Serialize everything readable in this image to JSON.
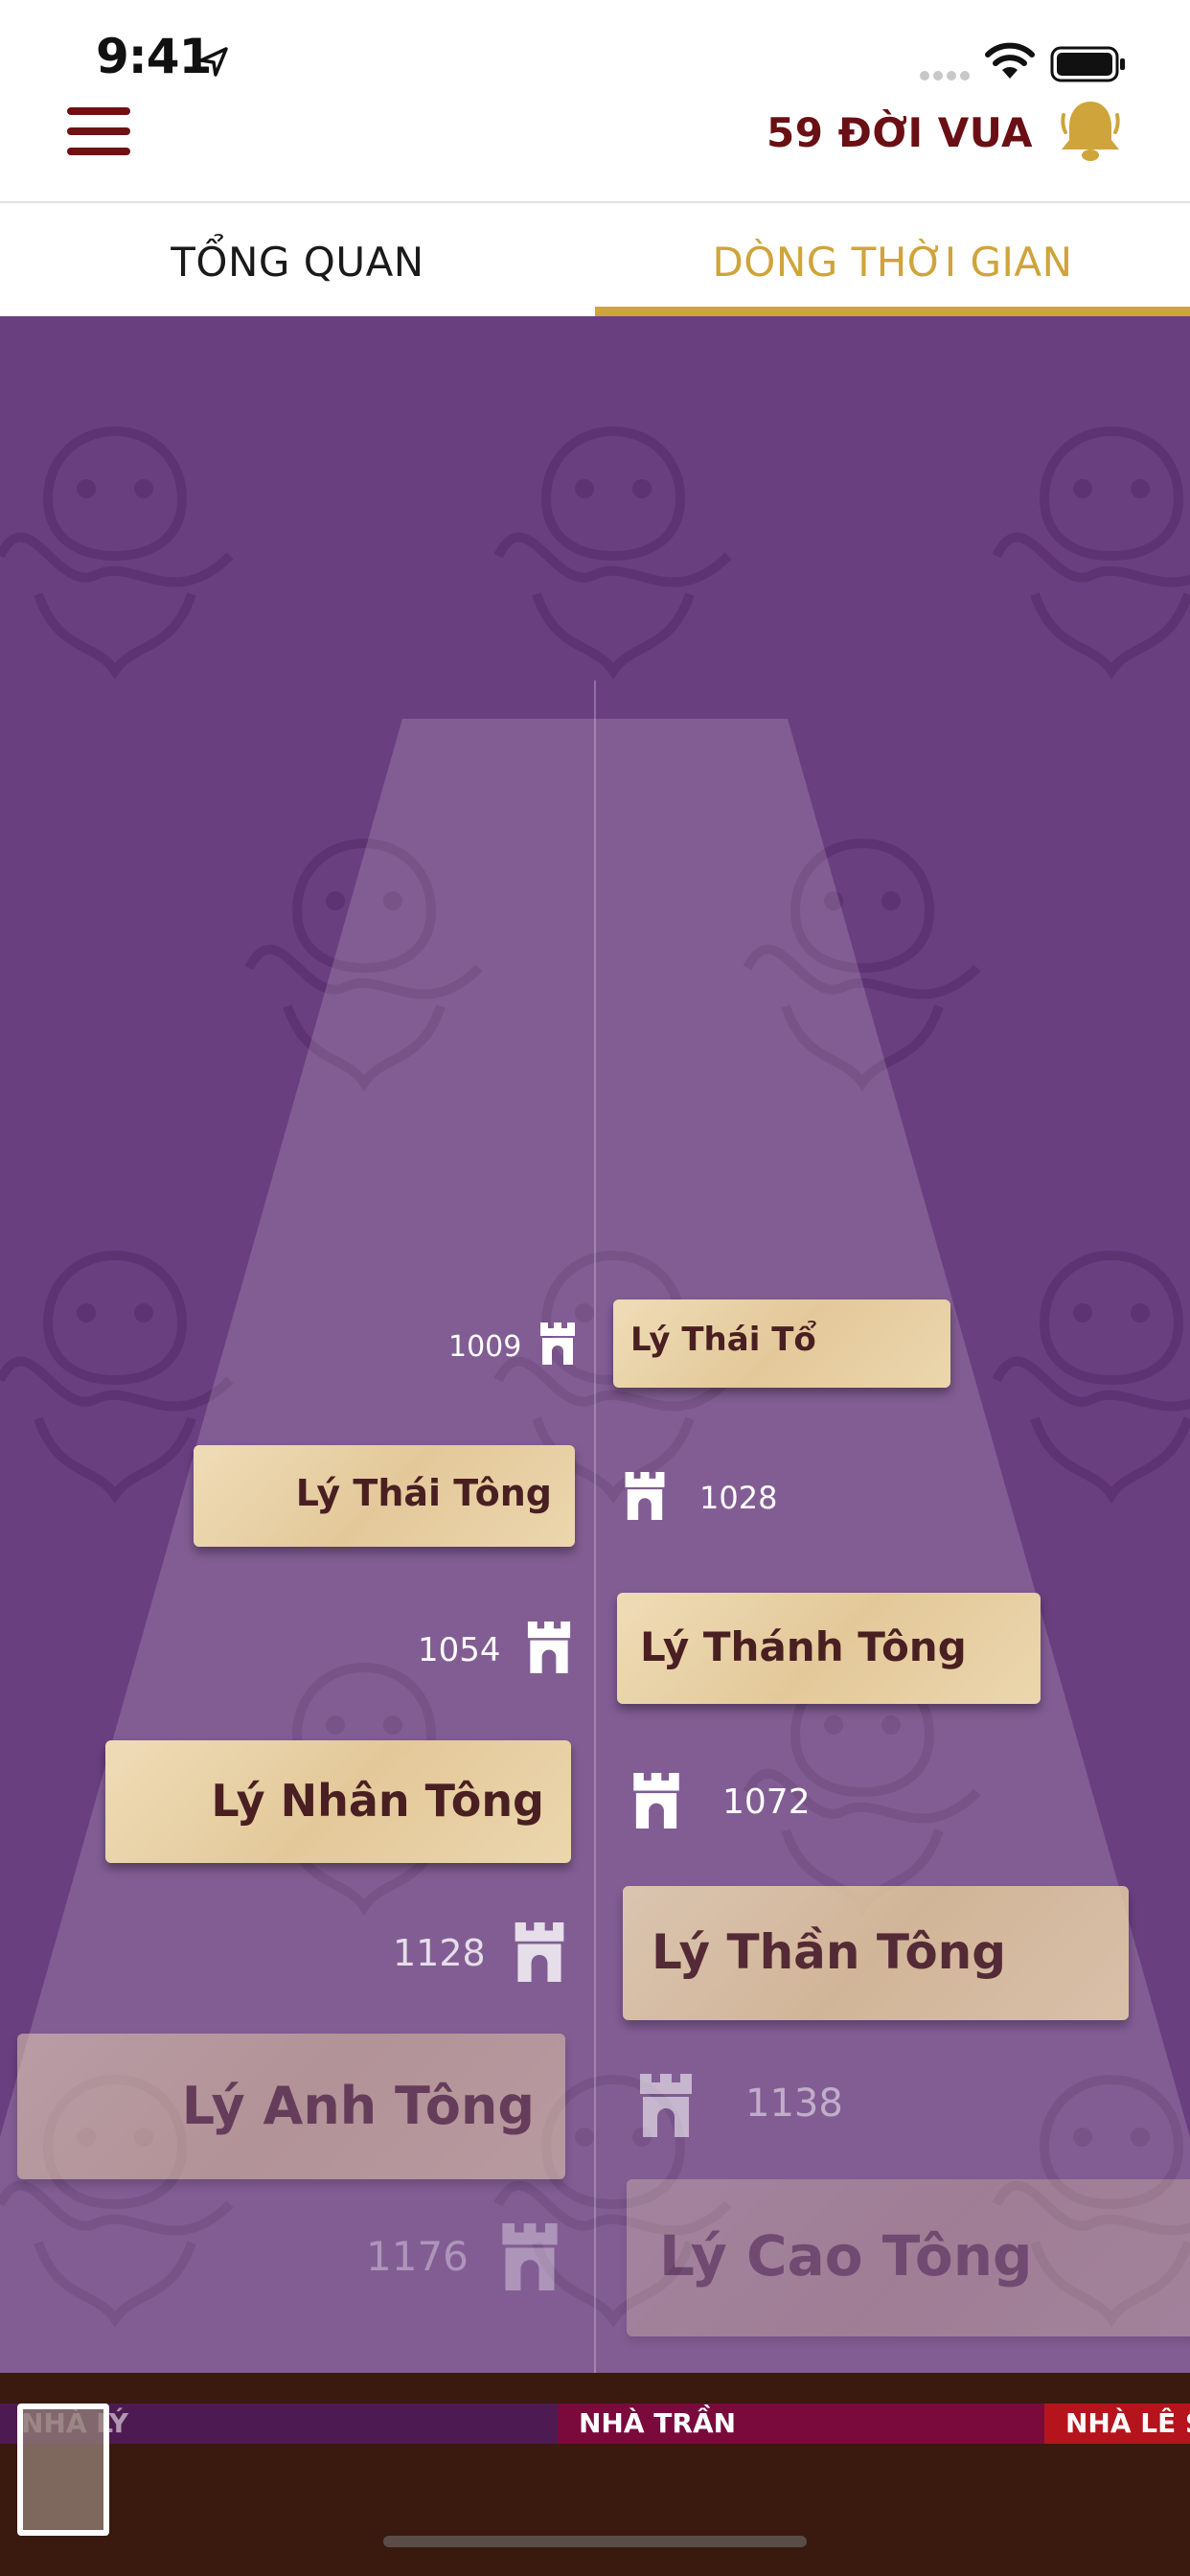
{
  "status_bar": {
    "time": "9:41"
  },
  "nav": {
    "title": "59 ĐỜI VUA"
  },
  "tabs": [
    {
      "label": "TỔNG QUAN",
      "active": false
    },
    {
      "label": "DÒNG THỜI GIAN",
      "active": true
    }
  ],
  "colors": {
    "accent_gold": "#cfa43a",
    "brand_maroon": "#6a0f14",
    "timeline_bg": "#6a3f80",
    "card_parchment": "#e8d2a8"
  },
  "timeline": {
    "kings": [
      {
        "name": "Lý Thái Tổ",
        "year": "1009",
        "side": "right"
      },
      {
        "name": "Lý Thái Tông",
        "year": "1028",
        "side": "left"
      },
      {
        "name": "Lý Thánh Tông",
        "year": "1054",
        "side": "right"
      },
      {
        "name": "Lý Nhân Tông",
        "year": "1072",
        "side": "left"
      },
      {
        "name": "Lý Thần Tông",
        "year": "1128",
        "side": "right"
      },
      {
        "name": "Lý Anh Tông",
        "year": "1138",
        "side": "left"
      },
      {
        "name": "Lý Cao Tông",
        "year": "1176",
        "side": "right"
      }
    ]
  },
  "dynasties": [
    {
      "label": "NHÀ LÝ",
      "color": "#4e1a52"
    },
    {
      "label": "NHÀ TRẦN",
      "color": "#7a0a3c"
    },
    {
      "label": "NHÀ LÊ SƠ",
      "color": "#b5141c"
    }
  ],
  "icons": {
    "menu": "hamburger-icon",
    "bell": "bell-icon",
    "tower": "citadel-tower-icon"
  }
}
